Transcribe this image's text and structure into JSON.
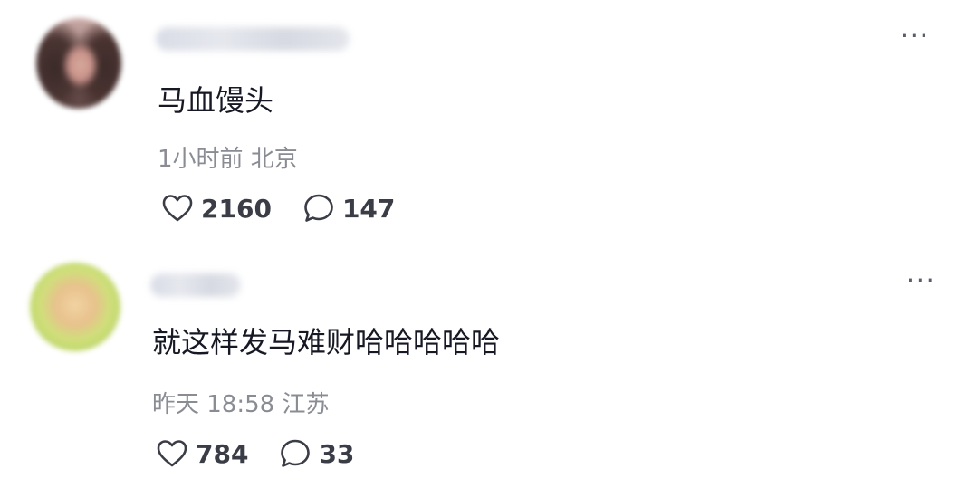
{
  "comments": [
    {
      "text": "马血馒头",
      "meta": "1小时前 北京",
      "likes": "2160",
      "replies": "147",
      "icons": {
        "like": "heart-outline-icon",
        "reply": "chat-bubble-icon",
        "more": "ellipsis-icon"
      }
    },
    {
      "text": "就这样发马难财哈哈哈哈哈",
      "meta": "昨天 18:58 江苏",
      "likes": "784",
      "replies": "33",
      "icons": {
        "like": "heart-outline-icon",
        "reply": "chat-bubble-icon",
        "more": "ellipsis-icon"
      }
    }
  ],
  "more_glyph": "···"
}
